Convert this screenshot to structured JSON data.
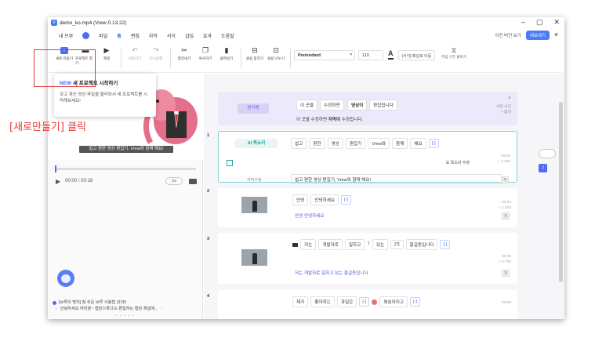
{
  "window": {
    "title": "demo_ko.mp4 (Vrew 0.13.22)",
    "controls": [
      "–",
      "▢",
      "✕"
    ]
  },
  "menu": {
    "my": "내 브루",
    "file": "파일",
    "home": "홈",
    "edit": "편집",
    "subtitle": "자막",
    "format": "서식",
    "insert": "삽입",
    "effect": "효과",
    "help": "도움말",
    "prev_version": "이전 버전 보기",
    "share": "내보내기"
  },
  "toolbar": {
    "new": "새로 만들기",
    "open": "프로젝트 열기",
    "play": "재생",
    "undo": "되돌리기",
    "redo": "다시실행",
    "cut": "잘라내기",
    "copy": "복사하기",
    "paste": "붙여넣기",
    "merge": "클립 합치기",
    "split": "클립 나누기",
    "font": "Pretendard",
    "size": "110",
    "color_letter": "A",
    "more": "[서식] 패널로 이동",
    "silent": "무음 구간 줄이기"
  },
  "popup": {
    "badge": "NEW",
    "title": "새 프로젝트 시작하기",
    "desc": "갖고 계신 영상 파일을 불러와서 새 프로젝트를 시작해보세요!"
  },
  "video": {
    "caption": "쉽고 편한 영상 편집기, Vrew와 함께 해요!",
    "time": "00:00 / 00:18",
    "speed": "1x"
  },
  "news": {
    "line1": "[브루의 명저] 참 쉬운 브루 사용법 강의5",
    "line2": "안녕하세요 여러분~ 캡틴스튜디오-편집하는 캡틴 채널에...",
    "arrow_left": "‹",
    "arrow_right": "›",
    "dots": "• • • • •"
  },
  "banner": {
    "tag": "텐라맹",
    "words": [
      "이 곳을",
      "수정하면",
      "영상이",
      "편집됩니다"
    ],
    "line2_pre": "이 곳을 수정하면 ",
    "line2_bold": "자막이",
    "line2_post": " 수정됩니다.",
    "close": "×",
    "time_label": "사작 시간",
    "time_val": "+ 없이"
  },
  "clips": [
    {
      "num": "1",
      "ai": "AI 목소리",
      "words": [
        "쉽고",
        "편한",
        "영상",
        "편집기",
        "Vrew와",
        "함께",
        "해요"
      ],
      "voice": "목소리 수정",
      "edit_label": "자막수정",
      "subtitle": "쉽고 편한 영상 편집기, Vrew와 함께 해요!",
      "time": "00:00",
      "dur": "+ 4.155",
      "ga": "가"
    },
    {
      "num": "2",
      "words": [
        "안녕",
        "안녕하세요"
      ],
      "subtitle": "안녕 안녕하세요",
      "time": "00:04",
      "dur": "+ 1.825",
      "ga": "가"
    },
    {
      "num": "3",
      "words": [
        "저는",
        "개발자로",
        "일하고",
        "있는",
        "[?]",
        "홍길동입니다"
      ],
      "subtitle": "저는 개발자로 일하고 있는 홍길동입니다",
      "time": "00:05",
      "dur": "+ 2.758",
      "ga": "가"
    },
    {
      "num": "4",
      "words": [
        "제가",
        "좋아하는",
        "과일은",
        "복숭아이고"
      ],
      "time": "00:08"
    }
  ],
  "plus": "[-]",
  "annotation": "[새로만들기] 클릭"
}
